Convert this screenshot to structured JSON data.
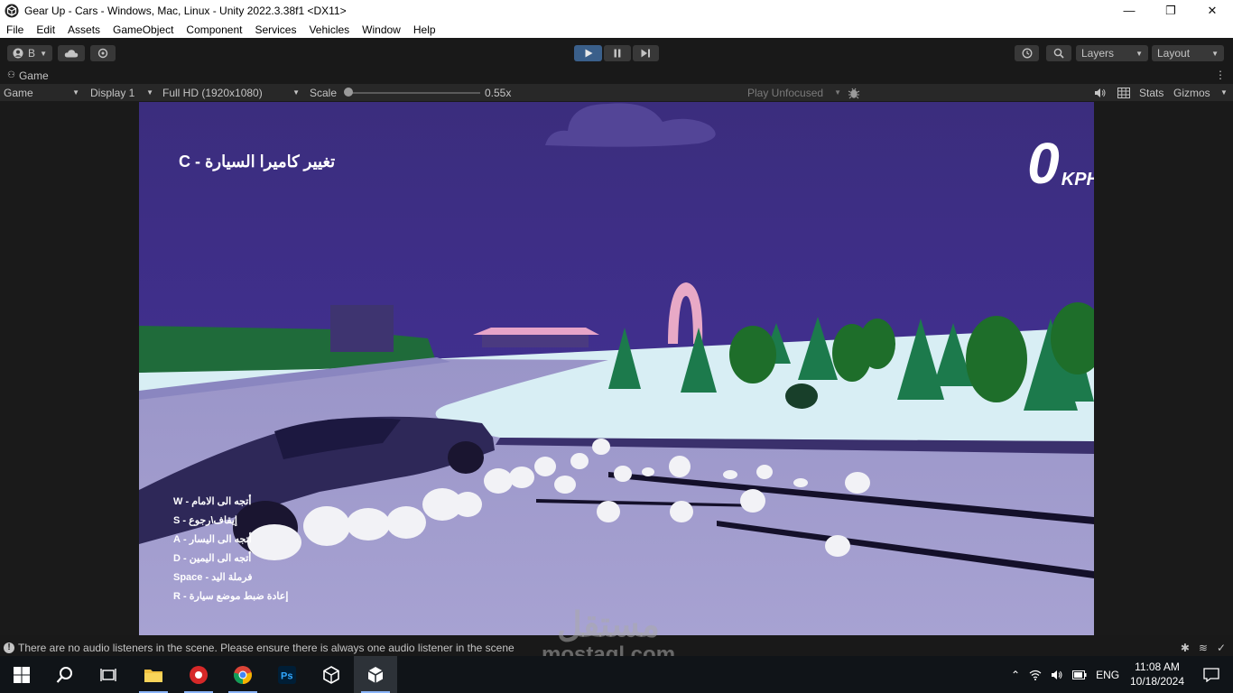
{
  "window": {
    "title": "Gear Up - Cars - Windows, Mac, Linux - Unity 2022.3.38f1 <DX11>",
    "minimize": "—",
    "maximize": "❐",
    "close": "✕"
  },
  "menu": [
    "File",
    "Edit",
    "Assets",
    "GameObject",
    "Component",
    "Services",
    "Vehicles",
    "Window",
    "Help"
  ],
  "toolbar": {
    "account_label": "B",
    "layers_label": "Layers",
    "layout_label": "Layout"
  },
  "game_tab": {
    "label": "Game",
    "more": "⋮"
  },
  "game_bar": {
    "view_mode": "Game",
    "display": "Display 1",
    "resolution": "Full HD (1920x1080)",
    "scale_label": "Scale",
    "scale_value": "0.55x",
    "play_focus": "Play Unfocused",
    "stats": "Stats",
    "gizmos": "Gizmos"
  },
  "hud": {
    "camera_hint": "C - تغيير كاميرا السيارة",
    "speed": "0",
    "speed_unit": "KPH",
    "controls": [
      {
        "key": "W",
        "text": "- أتجه الى الامام"
      },
      {
        "key": "S",
        "text": "- إيقاف\\رجوع"
      },
      {
        "key": "A",
        "text": "- أتجه الى اليسار"
      },
      {
        "key": "D",
        "text": "- أتجه الى اليمين"
      },
      {
        "key": "Space",
        "text": "- فرملة اليد"
      },
      {
        "key": "R",
        "text": "- إعادة ضبط موضع سيارة"
      }
    ]
  },
  "status": {
    "message": "There are no audio listeners in the scene. Please ensure there is always one audio listener in the scene"
  },
  "watermark": {
    "arabic": "مستقل",
    "latin": "mostaql.com"
  },
  "taskbar": {
    "language": "ENG",
    "time": "11:08 AM",
    "date": "10/18/2024"
  }
}
